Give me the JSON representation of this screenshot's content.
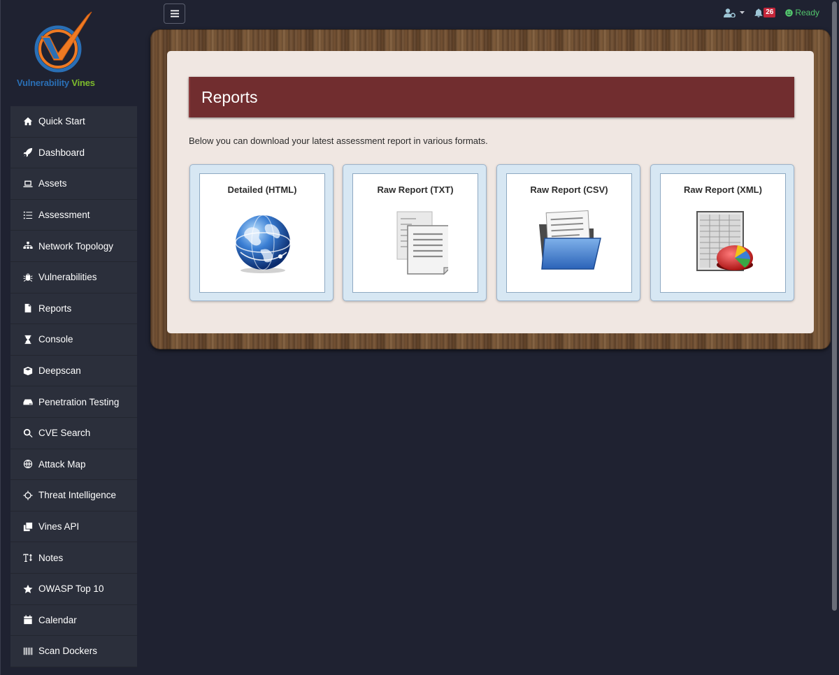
{
  "brand": {
    "name_part1": "Vulnerability",
    "name_part2": "Vines"
  },
  "topbar": {
    "notification_count": "26",
    "status_label": "Ready"
  },
  "sidebar": {
    "items": [
      {
        "label": "Quick Start",
        "icon": "home-icon"
      },
      {
        "label": "Dashboard",
        "icon": "rocket-icon"
      },
      {
        "label": "Assets",
        "icon": "laptop-icon"
      },
      {
        "label": "Assessment",
        "icon": "list-icon"
      },
      {
        "label": "Network Topology",
        "icon": "sitemap-icon"
      },
      {
        "label": "Vulnerabilities",
        "icon": "bug-icon"
      },
      {
        "label": "Reports",
        "icon": "file-icon"
      },
      {
        "label": "Console",
        "icon": "hourglass-icon"
      },
      {
        "label": "Deepscan",
        "icon": "cube-icon"
      },
      {
        "label": "Penetration Testing",
        "icon": "hdd-icon"
      },
      {
        "label": "CVE Search",
        "icon": "search-icon"
      },
      {
        "label": "Attack Map",
        "icon": "globe-icon"
      },
      {
        "label": "Threat Intelligence",
        "icon": "crosshairs-icon"
      },
      {
        "label": "Vines API",
        "icon": "clone-icon"
      },
      {
        "label": "Notes",
        "icon": "text-height-icon"
      },
      {
        "label": "OWASP Top 10",
        "icon": "star-icon"
      },
      {
        "label": "Calendar",
        "icon": "calendar-icon"
      },
      {
        "label": "Scan Dockers",
        "icon": "barcode-icon"
      }
    ]
  },
  "main": {
    "title": "Reports",
    "intro": "Below you can download your latest assessment report in various formats.",
    "reports": [
      {
        "label": "Detailed (HTML)",
        "icon": "globe-image"
      },
      {
        "label": "Raw Report (TXT)",
        "icon": "documents-image"
      },
      {
        "label": "Raw Report (CSV)",
        "icon": "folder-image"
      },
      {
        "label": "Raw Report (XML)",
        "icon": "spreadsheet-chart-image"
      }
    ]
  }
}
